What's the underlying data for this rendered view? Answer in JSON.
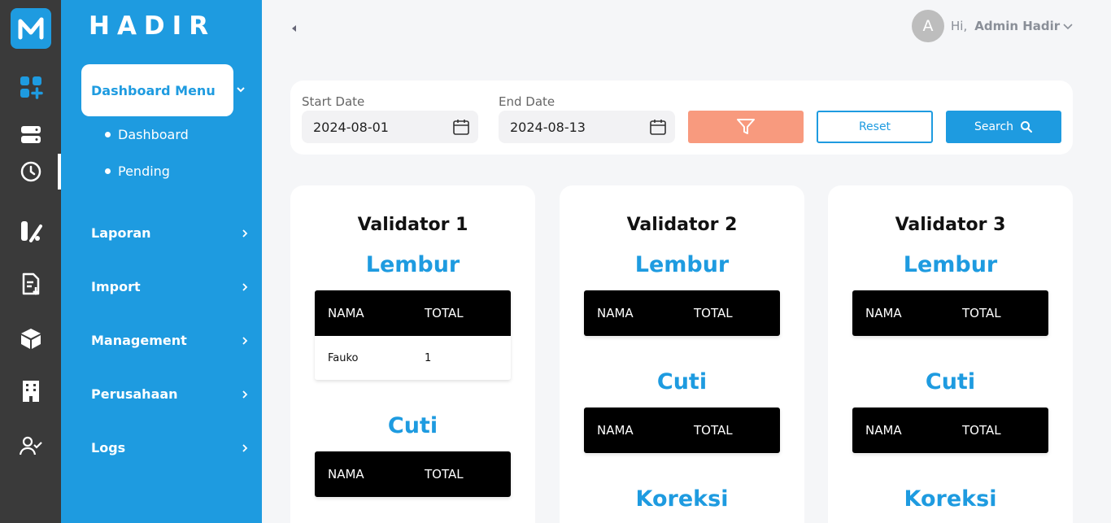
{
  "brand": "HADIR",
  "rail": {
    "icons": [
      "dashboard-plus-icon",
      "server-icon",
      "clock-icon",
      "attendance-icon",
      "document-download-icon",
      "box-icon",
      "building-icon",
      "user-check-icon"
    ]
  },
  "sidebar": {
    "active_menu": "Dashboard Menu",
    "sub_items": [
      "Dashboard",
      "Pending"
    ],
    "items": [
      {
        "label": "Laporan"
      },
      {
        "label": "Import"
      },
      {
        "label": "Management"
      },
      {
        "label": "Perusahaan"
      },
      {
        "label": "Logs"
      }
    ]
  },
  "header": {
    "avatar_letter": "A",
    "greeting": "Hi,",
    "user_name": "Admin Hadir"
  },
  "filter": {
    "start_label": "Start Date",
    "start_value": "2024-08-01",
    "end_label": "End Date",
    "end_value": "2024-08-13",
    "reset_label": "Reset",
    "search_label": "Search"
  },
  "validators": [
    {
      "title": "Validator 1",
      "sections": [
        {
          "title": "Lembur",
          "col_name": "NAMA",
          "col_total": "TOTAL",
          "rows": [
            {
              "name": "Fauko",
              "total": "1"
            }
          ]
        },
        {
          "title": "Cuti",
          "col_name": "NAMA",
          "col_total": "TOTAL",
          "rows": []
        }
      ]
    },
    {
      "title": "Validator 2",
      "sections": [
        {
          "title": "Lembur",
          "col_name": "NAMA",
          "col_total": "TOTAL",
          "rows": []
        },
        {
          "title": "Cuti",
          "col_name": "NAMA",
          "col_total": "TOTAL",
          "rows": []
        },
        {
          "title": "Koreksi"
        }
      ]
    },
    {
      "title": "Validator 3",
      "sections": [
        {
          "title": "Lembur",
          "col_name": "NAMA",
          "col_total": "TOTAL",
          "rows": []
        },
        {
          "title": "Cuti",
          "col_name": "NAMA",
          "col_total": "TOTAL",
          "rows": []
        },
        {
          "title": "Koreksi"
        }
      ]
    }
  ],
  "colors": {
    "primary": "#1e9be0",
    "filter_button": "#f89a7e",
    "rail": "#3a3a3a"
  }
}
